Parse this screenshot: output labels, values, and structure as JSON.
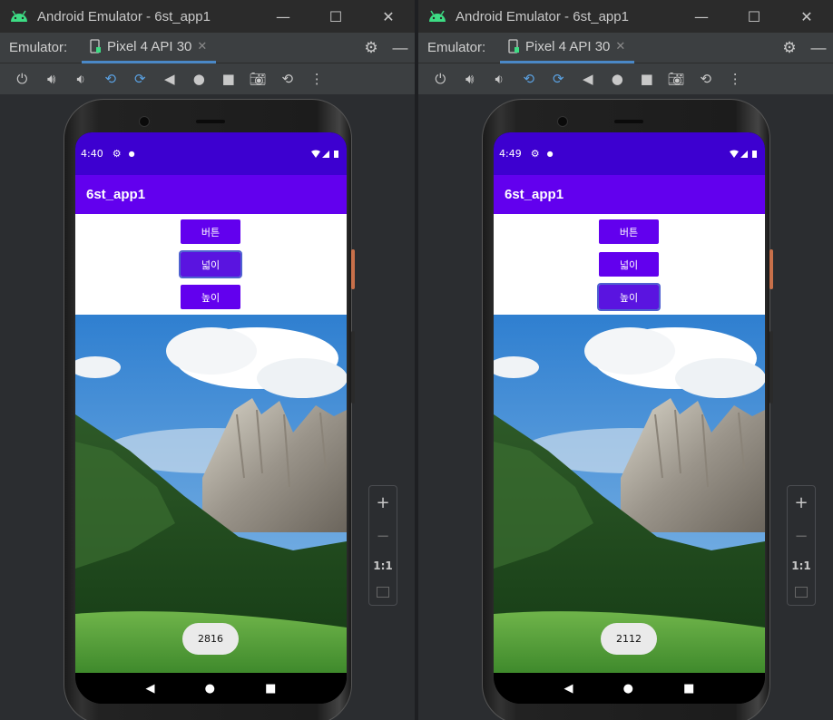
{
  "windows": [
    {
      "title": "Android Emulator - 6st_app1",
      "emulator_label": "Emulator:",
      "tab_label": "Pixel 4 API 30",
      "status_time": "4:40",
      "app_title": "6st_app1",
      "buttons": [
        "버튼",
        "넓이",
        "높이"
      ],
      "focused_button": 1,
      "toast_text": "2816"
    },
    {
      "title": "Android Emulator - 6st_app1",
      "emulator_label": "Emulator:",
      "tab_label": "Pixel 4 API 30",
      "status_time": "4:49",
      "app_title": "6st_app1",
      "buttons": [
        "버튼",
        "넓이",
        "높이"
      ],
      "focused_button": 2,
      "toast_text": "2112"
    }
  ],
  "window_controls": {
    "minimize": "—",
    "maximize": "☐",
    "close": "✕"
  },
  "toolbar_icons": [
    "power-icon",
    "volume-up-icon",
    "volume-down-icon",
    "rotate-left-icon",
    "rotate-right-icon",
    "back-icon",
    "home-icon",
    "overview-icon",
    "camera-icon",
    "snapshot-icon",
    "more-icon"
  ],
  "zoom_controls": {
    "plus": "+",
    "minus": "−",
    "one_to_one": "1:1"
  },
  "colors": {
    "accent": "#6200ee",
    "status_bar": "#3d00d0",
    "tab_underline": "#4a88c7"
  }
}
